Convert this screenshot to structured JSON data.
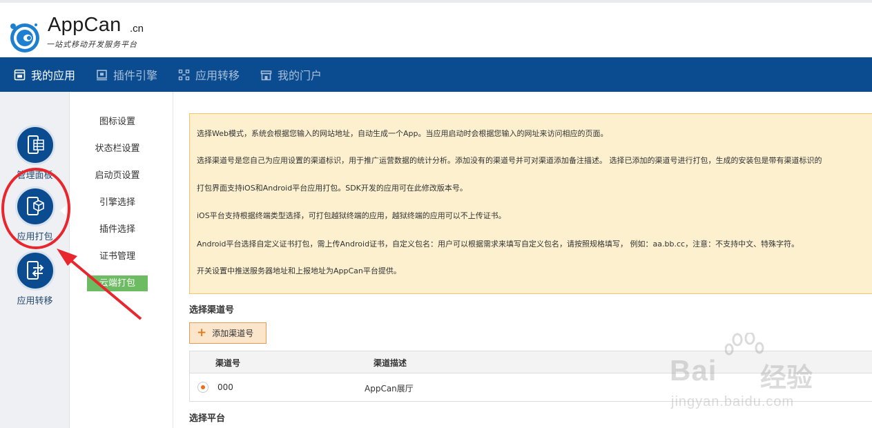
{
  "header": {
    "logo_word": "AppCan",
    "logo_domain": ".cn",
    "logo_tagline": "一站式移动开发服务平台"
  },
  "navbar": {
    "items": [
      {
        "label": "我的应用",
        "icon": "app-window-icon",
        "active": true
      },
      {
        "label": "插件引擎",
        "icon": "plugin-frame-icon",
        "active": false
      },
      {
        "label": "应用转移",
        "icon": "transfer-grid-icon",
        "active": false
      },
      {
        "label": "我的门户",
        "icon": "portal-store-icon",
        "active": false
      }
    ]
  },
  "rail": {
    "items": [
      {
        "label": "管理面板",
        "icon": "phone-grid-icon"
      },
      {
        "label": "应用打包",
        "icon": "phone-box-icon"
      },
      {
        "label": "应用转移",
        "icon": "phone-arrows-icon"
      }
    ]
  },
  "submenu": {
    "items": [
      "图标设置",
      "状态栏设置",
      "启动页设置",
      "引擎选择",
      "插件选择",
      "证书管理",
      "云端打包"
    ],
    "active_index": 6
  },
  "notice": {
    "lines": [
      "选择Web模式，系统会根据您输入的网站地址，自动生成一个App。当应用启动时会根据您输入的网址来访问相应的页面。",
      "选择渠道号是您自己为应用设置的渠道标识，用于推广运营数据的统计分析。添加没有的渠道号并可对渠道添加备注描述。 选择已添加的渠道号进行打包，生成的安装包是带有渠道标识的",
      "打包界面支持iOS和Android平台应用打包。SDK开发的应用可在此修改版本号。",
      "iOS平台支持根据终端类型选择，可打包越狱终端的应用，越狱终端的应用可以不上传证书。",
      "Android平台选择自定义证书打包，需上传Android证书，自定义包名：用户可以根据需求来填写自定义包名，请按照规格填写， 例如：aa.bb.cc，注意：不支持中文、特殊字符。",
      "开关设置中推送服务器地址和上报地址为AppCan平台提供。"
    ]
  },
  "channel": {
    "section_title": "选择渠道号",
    "add_button": "添加渠道号",
    "columns": [
      "渠道号",
      "渠道描述"
    ],
    "rows": [
      {
        "id": "000",
        "desc": "AppCan展厅",
        "selected": true
      }
    ]
  },
  "platform": {
    "section_title": "选择平台"
  },
  "watermark": {
    "word": "Bai",
    "cn": "经验",
    "sub": "jingyan.baidu.com"
  },
  "colors": {
    "nav_bg": "#0a4c8f",
    "nav_active": "#ffffff",
    "nav_inactive": "#a9bfd9",
    "menu_active": "#6dbb63",
    "notice_bg": "#fdf0cf",
    "notice_border": "#f0c76b",
    "annotation_red": "#e8262d",
    "radio_selected": "#ef6c1a"
  }
}
